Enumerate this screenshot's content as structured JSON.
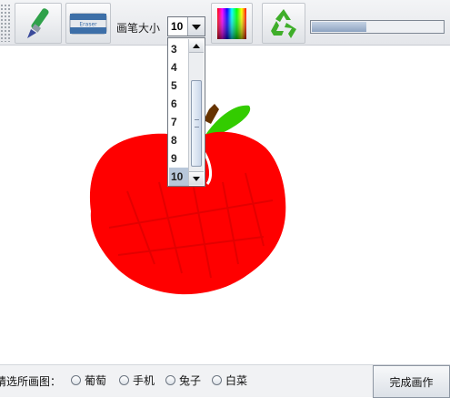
{
  "toolbar": {
    "size_label": "画笔大小",
    "size_value": "10",
    "icons": [
      "brush-icon",
      "eraser-icon",
      "color-palette-icon",
      "recycle-icon"
    ],
    "eraser_text": "Eraser",
    "progress_fraction": 0.42
  },
  "dropdown": {
    "options": [
      "3",
      "4",
      "5",
      "6",
      "7",
      "8",
      "9",
      "10"
    ],
    "selected": "10"
  },
  "drawing": {
    "apple_color": "#ff0000",
    "leaf_color": "#33cc00",
    "stem_color": "#663300"
  },
  "bottom": {
    "prompt": "请选所画图：",
    "choices": [
      "葡萄",
      "手机",
      "兔子",
      "白菜"
    ],
    "finish_label": "完成画作"
  }
}
